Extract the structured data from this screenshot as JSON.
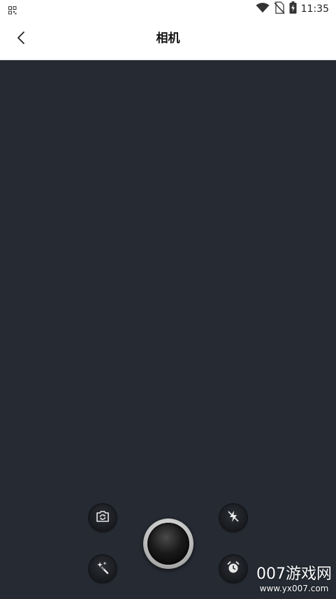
{
  "status_bar": {
    "time": "11:35",
    "icons": [
      "qr-icon",
      "wifi-icon",
      "no-sim-icon",
      "battery-charging-icon"
    ]
  },
  "header": {
    "title": "相机",
    "back_icon": "chevron-left-icon"
  },
  "camera": {
    "controls": [
      "switch-camera-icon",
      "flash-off-icon",
      "beauty-magic-icon",
      "timer-icon"
    ],
    "shutter": "shutter-button"
  },
  "watermark": {
    "logo": "007游戏网",
    "url": "www.yx007.com"
  },
  "colors": {
    "viewfinder_bg": "#252a33",
    "header_bg": "#ffffff",
    "control_bg": "#1c1e22"
  }
}
